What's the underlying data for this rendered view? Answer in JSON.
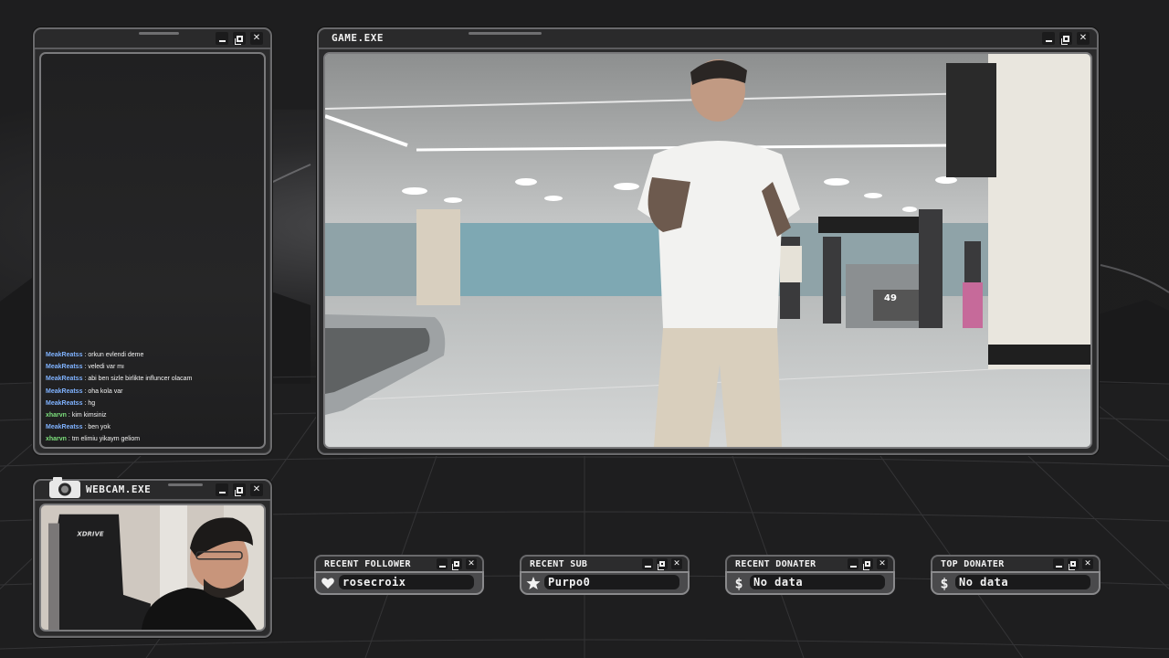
{
  "chat_window": {
    "messages": [
      {
        "user": "MeakReatss",
        "text": "orkun evlendi deme",
        "color": "#7fb2ff"
      },
      {
        "user": "MeakReatss",
        "text": "veledi var mı",
        "color": "#7fb2ff"
      },
      {
        "user": "MeakReatss",
        "text": "abi ben sizle birlikte influncer olacam",
        "color": "#7fb2ff"
      },
      {
        "user": "MeakReatss",
        "text": "oha kola var",
        "color": "#7fb2ff"
      },
      {
        "user": "MeakReatss",
        "text": "hg",
        "color": "#7fb2ff"
      },
      {
        "user": "xharvn",
        "text": "kim kimsiniz",
        "color": "#7de07d"
      },
      {
        "user": "MeakReatss",
        "text": "ben yok",
        "color": "#7fb2ff"
      },
      {
        "user": "xharvn",
        "text": "tm elimiu yikaym geliom",
        "color": "#7de07d"
      }
    ],
    "separator": " : "
  },
  "game_window": {
    "title": "GAME.EXE",
    "scene_sign": "49"
  },
  "webcam_window": {
    "title": "WEBCAM.EXE",
    "chair_brand": "XDRIVE"
  },
  "widgets": [
    {
      "label": "RECENT FOLLOWER",
      "value": "rosecroix",
      "icon": "heart-icon"
    },
    {
      "label": "RECENT SUB",
      "value": "Purpo0",
      "icon": "star-icon"
    },
    {
      "label": "RECENT DONATER",
      "value": "No data",
      "icon": "dollar-icon"
    },
    {
      "label": "TOP DONATER",
      "value": "No data",
      "icon": "dollar-icon"
    }
  ],
  "colors": {
    "frame": "#6a6a6c",
    "title_bar": "#2a2a2b",
    "chat_user_blue": "#7fb2ff",
    "chat_user_green": "#7de07d"
  }
}
